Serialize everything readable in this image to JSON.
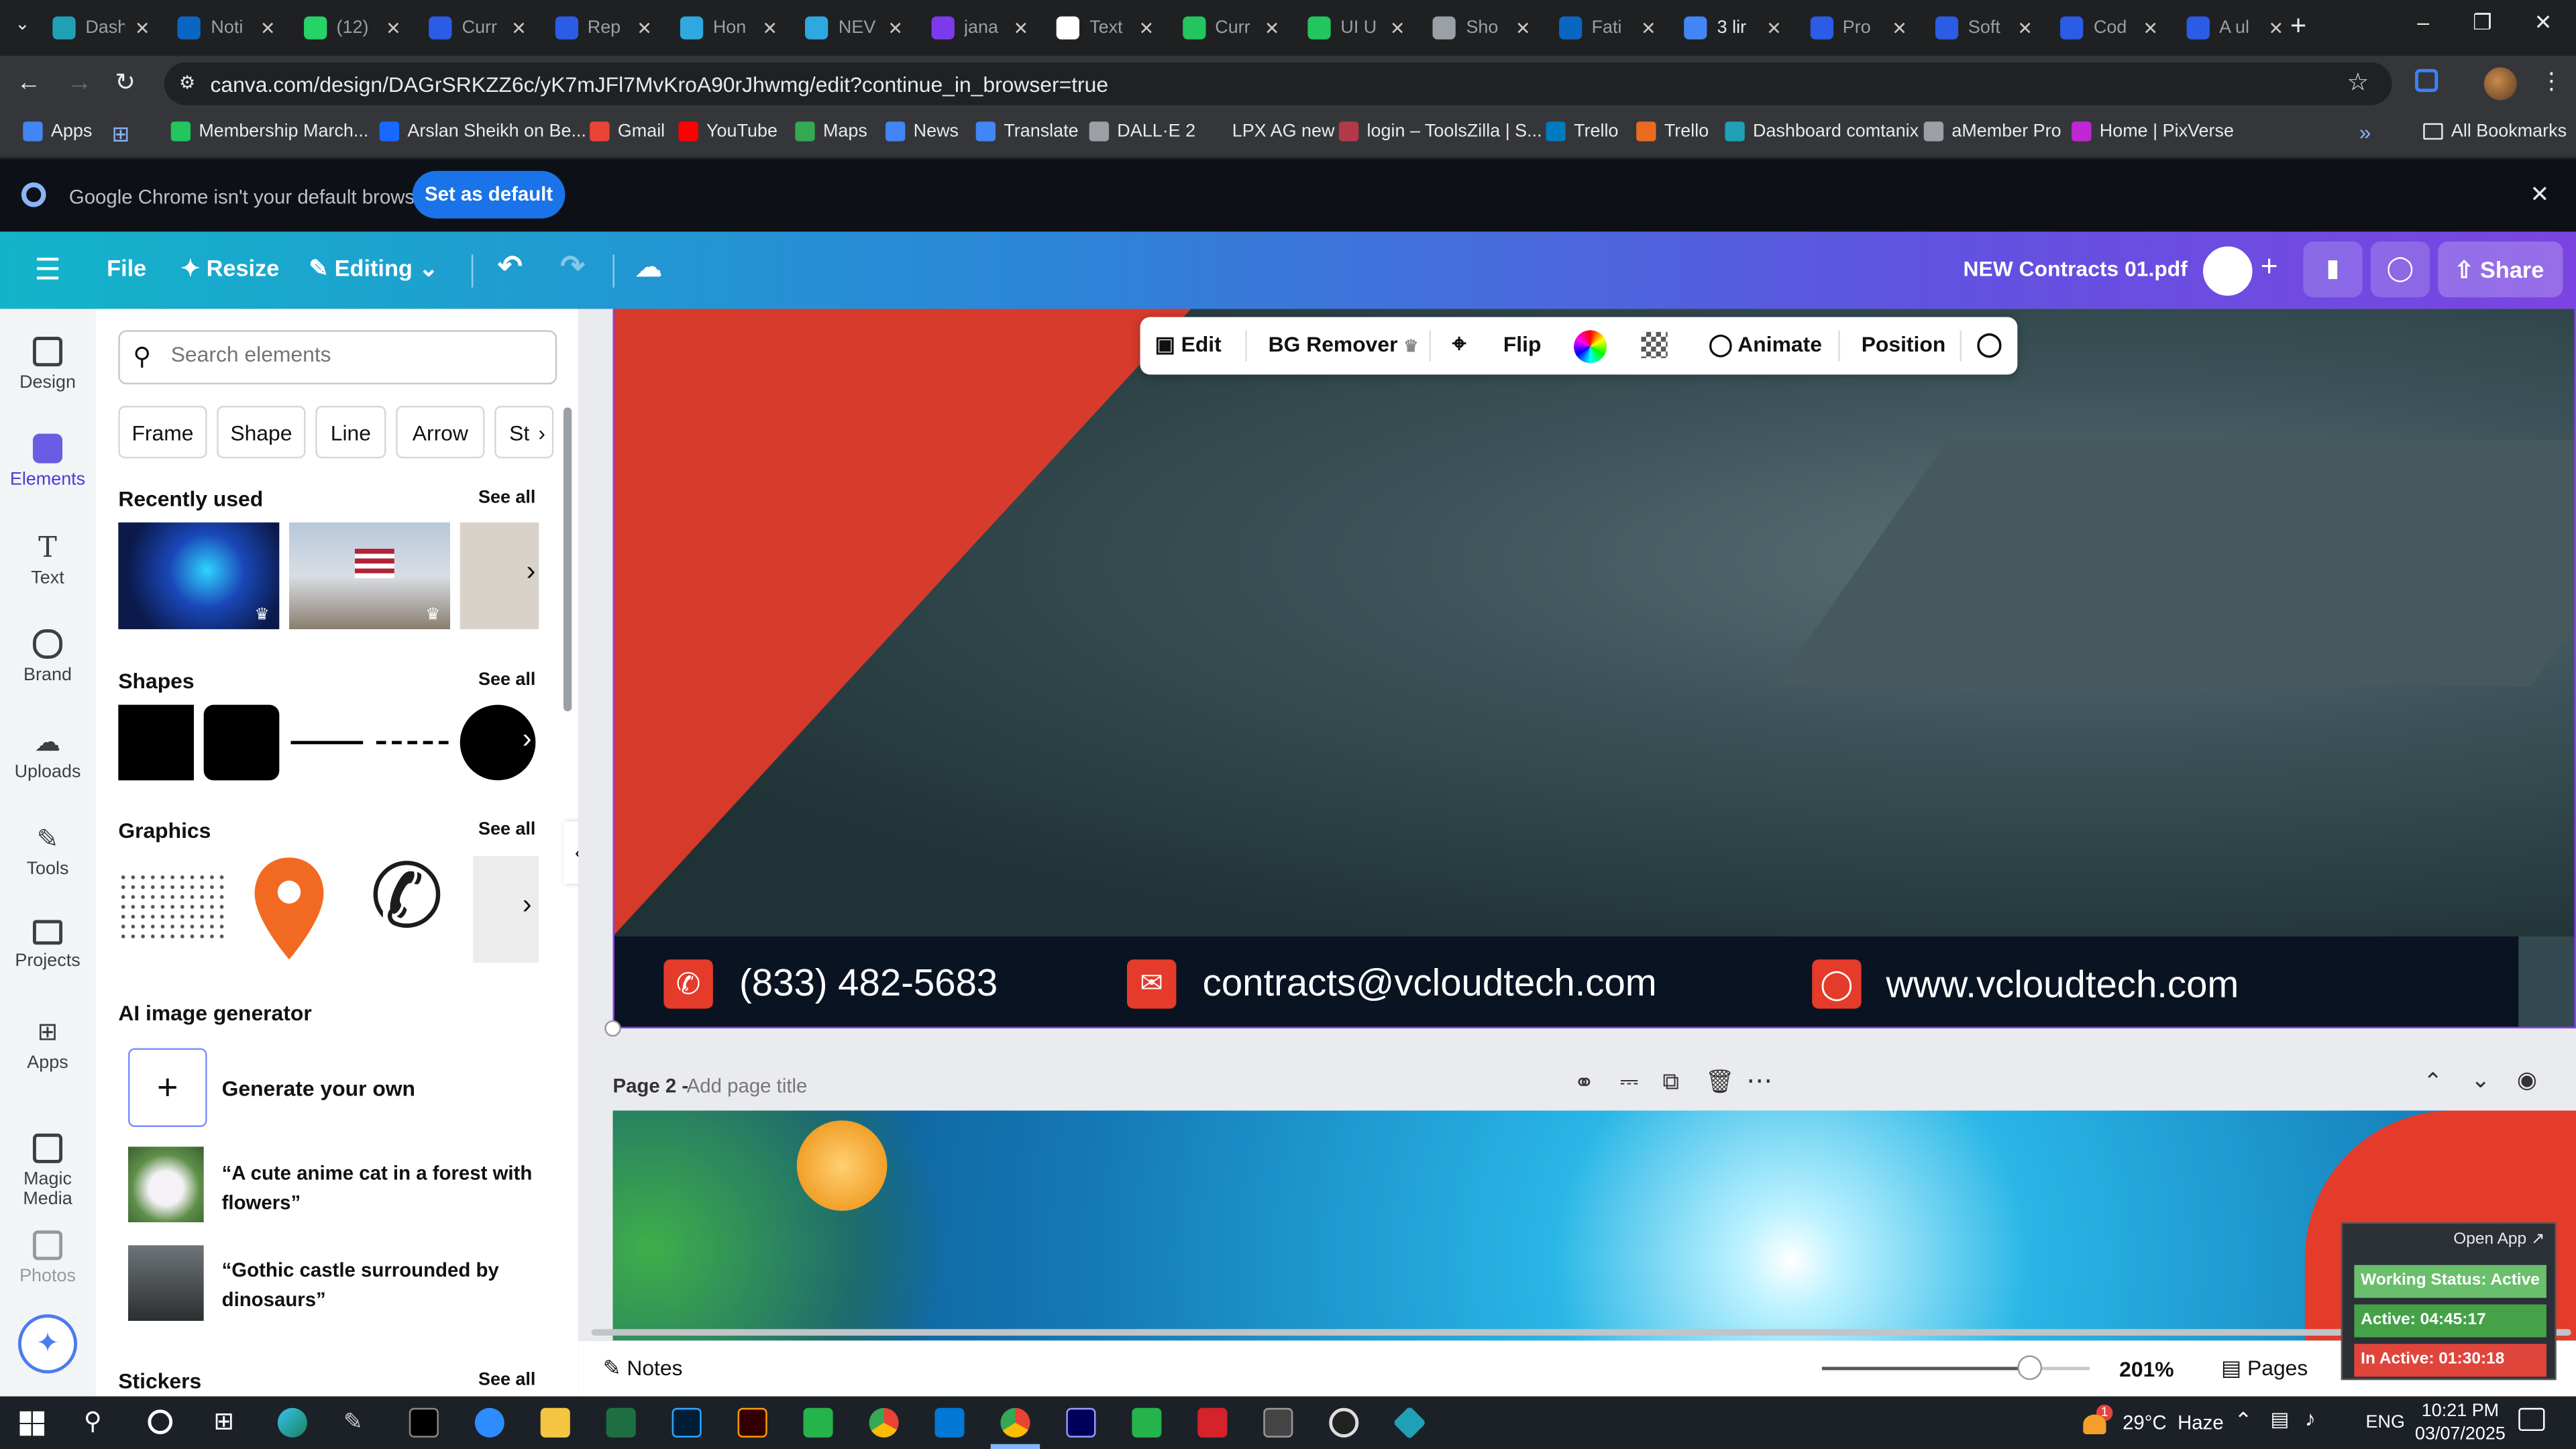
{
  "browser": {
    "tabs": [
      {
        "label": "Dash",
        "color": "#1fa0b5"
      },
      {
        "label": "Noti",
        "color": "#0a66c2"
      },
      {
        "label": "(12)",
        "color": "#25d366"
      },
      {
        "label": "Curr",
        "color": "#2b5ce6"
      },
      {
        "label": "Rep",
        "color": "#2b5ce6"
      },
      {
        "label": "Hon",
        "color": "#2fa8e0"
      },
      {
        "label": "NEV",
        "color": "#2fa8e0"
      },
      {
        "label": "jana",
        "color": "#7c3aed"
      },
      {
        "label": "Text",
        "color": "#ffffff"
      },
      {
        "label": "Curr",
        "color": "#22c55e"
      },
      {
        "label": "UI U",
        "color": "#22c55e"
      },
      {
        "label": "Sho",
        "color": "#9aa0a6"
      },
      {
        "label": "Fati",
        "color": "#0a66c2"
      },
      {
        "label": "3 lir",
        "color": "#4285f4"
      },
      {
        "label": "Pro",
        "color": "#2b5ce6"
      },
      {
        "label": "Soft",
        "color": "#2b5ce6"
      },
      {
        "label": "Cod",
        "color": "#2b5ce6"
      },
      {
        "label": "A ul",
        "color": "#2b5ce6"
      }
    ],
    "url": "canva.com/design/DAGrSRKZZ6c/yK7mJFl7MvKroA90rJhwmg/edit?continue_in_browser=true",
    "bookmarks": [
      {
        "label": "Apps",
        "color": "#4285f4"
      },
      {
        "label": "Membership March...",
        "color": "#22c55e"
      },
      {
        "label": "Arslan Sheikh on Be...",
        "color": "#1769ff"
      },
      {
        "label": "Gmail",
        "color": "#ea4335"
      },
      {
        "label": "YouTube",
        "color": "#ff0000"
      },
      {
        "label": "Maps",
        "color": "#34a853"
      },
      {
        "label": "News",
        "color": "#4285f4"
      },
      {
        "label": "Translate",
        "color": "#4285f4"
      },
      {
        "label": "DALL·E 2",
        "color": "#9aa0a6"
      },
      {
        "label": "LPX AG new",
        "color": "#35363a"
      },
      {
        "label": "login – ToolsZilla | S...",
        "color": "#b23a48"
      },
      {
        "label": "Trello",
        "color": "#0079bf"
      },
      {
        "label": "Trello",
        "color": "#e96b20"
      },
      {
        "label": "Dashboard comtanix",
        "color": "#1fa0b5"
      },
      {
        "label": "aMember Pro",
        "color": "#9aa0a6"
      },
      {
        "label": "Home | PixVerse",
        "color": "#c026d3"
      }
    ],
    "all_bookmarks": "All Bookmarks",
    "infobar_text": "Google Chrome isn't your default browser",
    "set_default_label": "Set as default"
  },
  "canva": {
    "file_label": "File",
    "resize_label": "Resize",
    "editing_label": "Editing",
    "doc_title": "NEW Contracts 01.pdf",
    "share_label": "Share",
    "rail": [
      "Design",
      "Elements",
      "Text",
      "Brand",
      "Uploads",
      "Tools",
      "Projects",
      "Apps",
      "Magic Media",
      "Photos"
    ],
    "search_placeholder": "Search elements",
    "chips": [
      "Frame",
      "Shape",
      "Line",
      "Arrow",
      "St"
    ],
    "recently_used": "Recently used",
    "shapes": "Shapes",
    "graphics": "Graphics",
    "ai_generator": "AI image generator",
    "see_all": "See all",
    "generate_own": "Generate your own",
    "prompt1": "“A cute anime cat in a forest with flowers”",
    "prompt2": "“Gothic castle surrounded by dinosaurs”",
    "stickers": "Stickers",
    "context_toolbar": {
      "edit": "Edit",
      "bg_remover": "BG Remover",
      "flip": "Flip",
      "animate": "Animate",
      "position": "Position"
    },
    "page1_footer": {
      "phone": "(833) 482-5683",
      "email": "contracts@vcloudtech.com",
      "web": "www.vcloudtech.com"
    },
    "page2_label": "Page 2 -",
    "page2_title_placeholder": "Add page title",
    "notes_label": "Notes",
    "zoom": "201%",
    "zoom_fraction": 0.77,
    "pages_label": "Pages"
  },
  "widget": {
    "open_app": "Open App ↗",
    "working": "Working Status: Active",
    "active": "Active: 04:45:17",
    "inactive": "In Active: 01:30:18"
  },
  "taskbar": {
    "weather": "29°C  Haze",
    "lang": "ENG",
    "time": "10:21 PM",
    "date": "03/07/2025",
    "weather_badge": "1"
  },
  "colors": {
    "accent": "#7b44e2",
    "teal": "#13b4c9",
    "red": "#e53b2a"
  }
}
